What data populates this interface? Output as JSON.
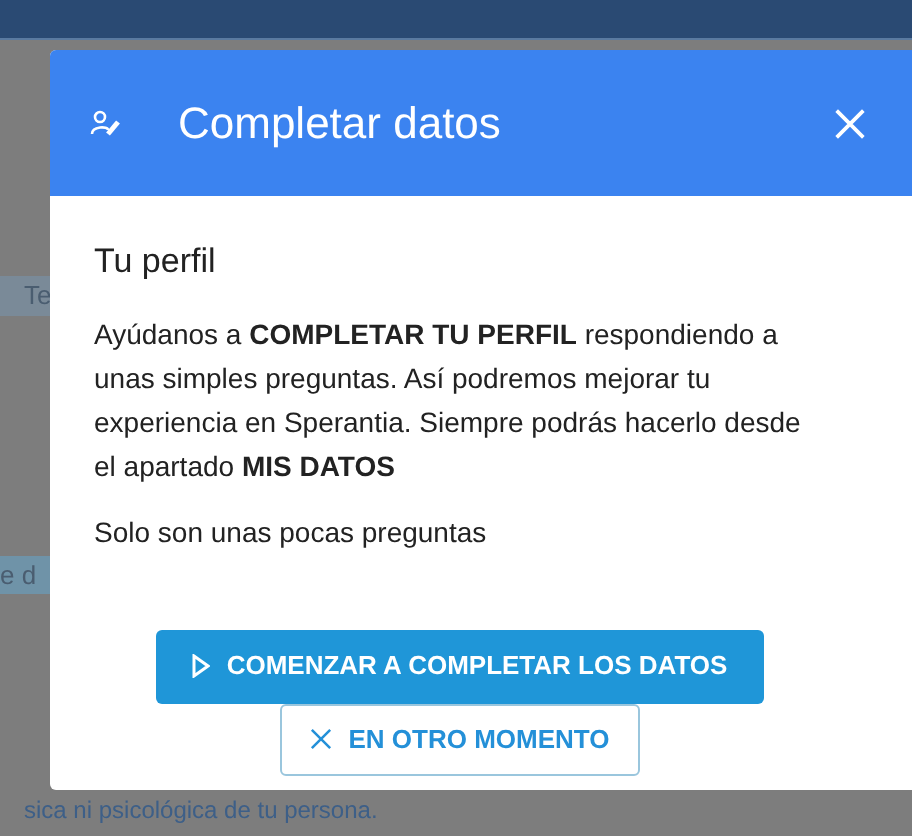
{
  "background": {
    "side_texts": [
      "Te",
      "e d"
    ],
    "footer_lines": [
      "sica ni psicológica de tu persona."
    ]
  },
  "dialog": {
    "title": "Completar datos",
    "heading": "Tu perfil",
    "paragraph": "Ayúdanos a **COMPLETAR TU PERFIL** respondiendo a unas simples preguntas. Así podremos mejorar tu experiencia en Sperantia. Siempre podrás hacerlo desde el apartado **MIS DATOS**",
    "note": "Solo son unas pocas preguntas",
    "buttons": [
      {
        "kind": "primary",
        "label": "COMENZAR A COMPLETAR LOS DATOS"
      },
      {
        "kind": "secondary",
        "label": "EN OTRO MOMENTO"
      }
    ]
  }
}
